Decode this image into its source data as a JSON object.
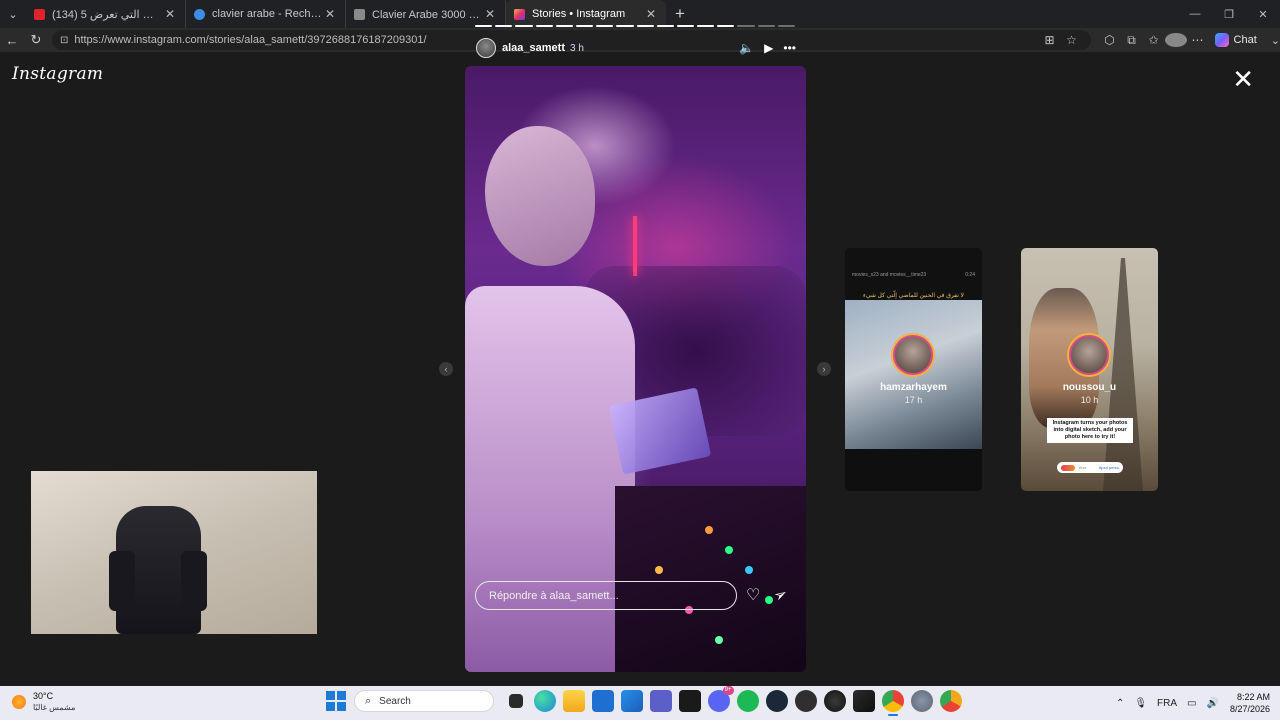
{
  "browser": {
    "tabs": [
      {
        "title": "(134) 5 من أخطر الهجمات التي تعرض",
        "favicon_color": "#e0222a",
        "active": false
      },
      {
        "title": "clavier arabe - Recherche",
        "favicon_color": "#3a8ee6",
        "active": false
      },
      {
        "title": "Clavier Arabe 3000 ™ الكتابة بالعربية",
        "favicon_color": "#8a8a8a",
        "active": false
      },
      {
        "title": "Stories • Instagram",
        "favicon_color": "#e1306c",
        "active": true
      }
    ],
    "tab_close_glyph": "✕",
    "new_tab_glyph": "+",
    "url": "https://www.instagram.com/stories/alaa_samett/3972688176187209301/",
    "chat_label": "Chat",
    "window_controls": [
      "—",
      "❐",
      "✕"
    ]
  },
  "instagram": {
    "logo_text": "Instagram",
    "close_glyph": "✕",
    "story": {
      "username": "alaa_samett",
      "time_ago": "3 h",
      "progress_total": 16,
      "progress_filled": 13,
      "reply_placeholder": "Répondre à alaa_samett...",
      "controls": {
        "mute": "🔈",
        "play": "▶",
        "more": "•••"
      },
      "like_glyph": "♡",
      "share_glyph": "➢"
    },
    "prev_glyph": "‹",
    "next_glyph": "›",
    "previews": [
      {
        "username": "hamzarhayem",
        "time_ago": "17 h",
        "handles_text": "movies_s23 and movies__time23",
        "duration_text": "0:24",
        "arabic_caption": "لا تفرق في الحنين للماضي إلّتي كل شيء"
      },
      {
        "username": "noussou_u",
        "time_ago": "10 h",
        "caption": "Instagram turns your photos into digital sketch, add your photo here to try it!",
        "pill_left": "Year",
        "pill_right": "Ajout perso"
      }
    ]
  },
  "taskbar": {
    "weather": {
      "temp": "30°C",
      "desc": "مشمس غالبًا"
    },
    "search_placeholder": "Search",
    "search_icon": "search-icon",
    "badges": {
      "discord": "9+"
    },
    "tray": {
      "lang": "FRA",
      "time": "8:22 AM",
      "date": "8/27/2026"
    },
    "icons": [
      "file-explorer",
      "edge",
      "folder",
      "outlook",
      "store",
      "teams",
      "notepad",
      "discord",
      "spotify",
      "steam",
      "obs",
      "xbox",
      "terminal",
      "chrome",
      "settings",
      "chrome-canary"
    ]
  },
  "colors": {
    "accent": "#1e7ad9",
    "ig_gradient_pink": "#d94a8c",
    "ig_gradient_gold": "#f2b33a"
  }
}
